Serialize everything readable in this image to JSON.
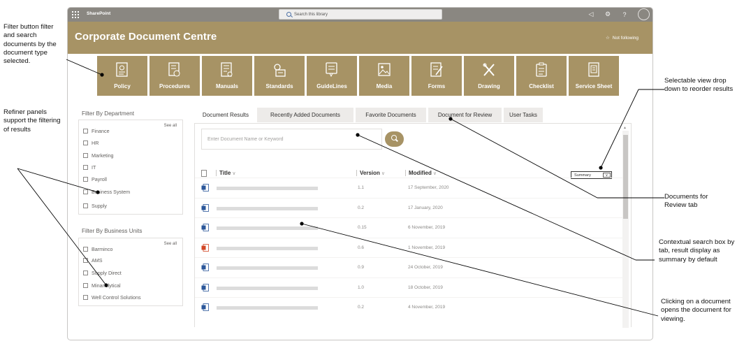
{
  "suitebar": {
    "brand": "SharePoint",
    "search_placeholder": "Search this library"
  },
  "site": {
    "title": "Corporate Document Centre",
    "follow_label": "Not following"
  },
  "tiles": [
    {
      "label": "Policy",
      "icon": "policy-icon"
    },
    {
      "label": "Procedures",
      "icon": "procedures-icon"
    },
    {
      "label": "Manuals",
      "icon": "manuals-icon"
    },
    {
      "label": "Standards",
      "icon": "standards-icon"
    },
    {
      "label": "GuideLines",
      "icon": "guidelines-icon"
    },
    {
      "label": "Media",
      "icon": "media-icon"
    },
    {
      "label": "Forms",
      "icon": "forms-icon"
    },
    {
      "label": "Drawing",
      "icon": "drawing-icon"
    },
    {
      "label": "Checklist",
      "icon": "checklist-icon"
    },
    {
      "label": "Service Sheet",
      "icon": "service-sheet-icon"
    }
  ],
  "filters": {
    "department": {
      "title": "Filter By Department",
      "see_all": "See all",
      "items": [
        "Finance",
        "HR",
        "Marketing",
        "IT",
        "Payroll",
        "Business System",
        "Supply"
      ]
    },
    "business_units": {
      "title": "Filter By Business Units",
      "see_all": "See all",
      "items": [
        "Barminco",
        "AMS",
        "Supply Direct",
        "Minanalytical",
        "Well Control Solutions"
      ]
    }
  },
  "tabs": [
    "Document Results",
    "Recently Added Documents",
    "Favorite Documents",
    "Document for Review",
    "User Tasks"
  ],
  "results": {
    "search_placeholder": "Enter Document Name or Keyword",
    "columns": {
      "title": "Title",
      "version": "Version",
      "modified": "Modified"
    },
    "view_select": "Summary",
    "rows": [
      {
        "type": "word",
        "version": "1.1",
        "modified": "17 September, 2020"
      },
      {
        "type": "word",
        "version": "0.2",
        "modified": "17 January, 2020"
      },
      {
        "type": "word",
        "version": "0.15",
        "modified": "6 November, 2019"
      },
      {
        "type": "pdf",
        "version": "0.6",
        "modified": "1 November, 2019"
      },
      {
        "type": "word",
        "version": "0.9",
        "modified": "24 October, 2019"
      },
      {
        "type": "word",
        "version": "1.0",
        "modified": "18 October, 2019"
      },
      {
        "type": "word",
        "version": "0.2",
        "modified": "4 November, 2019"
      }
    ]
  },
  "colors": {
    "accent": "#a79365",
    "suitebar": "#8a8781",
    "word": "#2b579a",
    "pdf": "#d24726"
  },
  "annotations": {
    "filter_button": "Filter button filter and search documents by the document type selected.",
    "refiner": "Refiner panels support the filtering of results",
    "view_dropdown": "Selectable view drop down to reorder results",
    "review_tab": "Documents for Review tab",
    "contextual_search": "Contextual search box by tab, result display as summary by default",
    "clicking_doc": "Clicking on a document opens the document for viewing."
  }
}
